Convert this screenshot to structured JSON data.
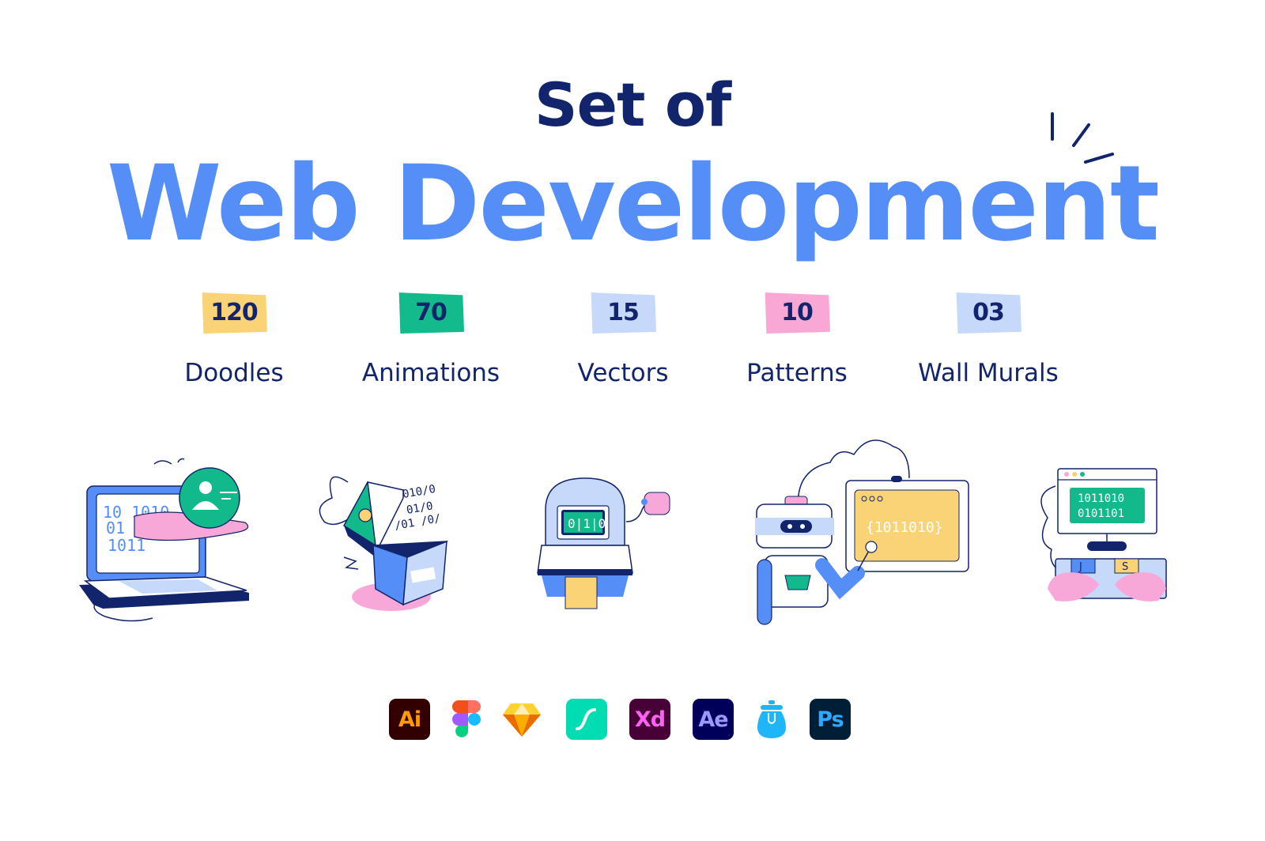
{
  "header": {
    "line1": "Set of",
    "line2": "Web Development"
  },
  "colors": {
    "navy": "#12246b",
    "blue": "#568ef7",
    "yellow": "#fbd377",
    "green": "#12b98a",
    "light_blue": "#c6d9fb",
    "pink": "#f8a8d8"
  },
  "stats": [
    {
      "count": "120",
      "label": "Doodles",
      "badge_color": "#fbd377"
    },
    {
      "count": "70",
      "label": "Animations",
      "badge_color": "#13bb8c"
    },
    {
      "count": "15",
      "label": "Vectors",
      "badge_color": "#c6d9fb"
    },
    {
      "count": "10",
      "label": "Patterns",
      "badge_color": "#f9a8d6"
    },
    {
      "count": "03",
      "label": "Wall Murals",
      "badge_color": "#c6d9fb"
    }
  ],
  "illustrations": [
    {
      "name": "laptop-hand-user",
      "binary": [
        "10 1010",
        "01",
        "1011"
      ]
    },
    {
      "name": "binary-gift-box",
      "binary": [
        "010/0",
        "01/0",
        "/01 /0/"
      ]
    },
    {
      "name": "robot-terminal",
      "binary": [
        "0|1|0"
      ]
    },
    {
      "name": "robot-with-screen",
      "binary": [
        "{1011010}"
      ]
    },
    {
      "name": "keyboard-monitor",
      "binary": [
        "1011010",
        "0101101"
      ],
      "keys": [
        "J",
        "S"
      ]
    }
  ],
  "tools": [
    {
      "id": "illustrator",
      "label": "Ai",
      "bg": "#330000",
      "fg": "#ff9a00"
    },
    {
      "id": "figma",
      "label": "",
      "bg": "transparent",
      "fg": ""
    },
    {
      "id": "sketch",
      "label": "",
      "bg": "transparent",
      "fg": ""
    },
    {
      "id": "lottie",
      "label": "",
      "bg": "#00ddb3",
      "fg": "#ffffff"
    },
    {
      "id": "xd",
      "label": "Xd",
      "bg": "#470137",
      "fg": "#ff61f6"
    },
    {
      "id": "after-effects",
      "label": "Ae",
      "bg": "#00005b",
      "fg": "#9999ff"
    },
    {
      "id": "iconjar",
      "label": "",
      "bg": "transparent",
      "fg": "#1eb6f9"
    },
    {
      "id": "photoshop",
      "label": "Ps",
      "bg": "#001e36",
      "fg": "#31a8ff"
    }
  ]
}
